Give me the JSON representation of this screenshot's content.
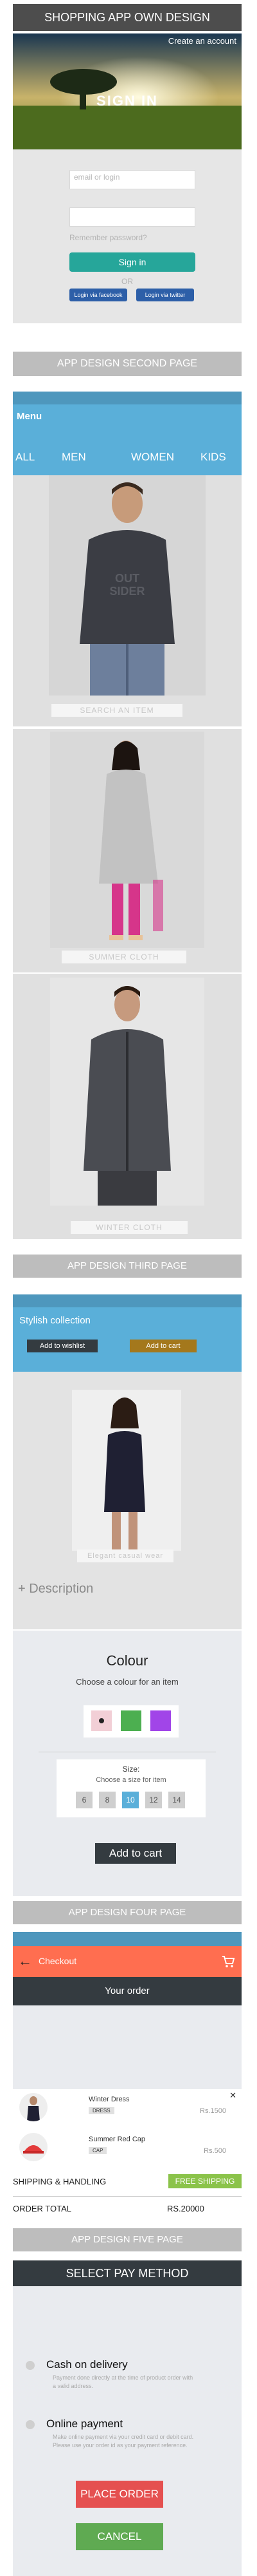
{
  "page1": {
    "header_title": "SHOPPING APP OWN DESIGN",
    "create_account": "Create an account",
    "sign_in_title": "SIGN IN",
    "email_placeholder": "email or login",
    "password_placeholder": "",
    "remember_password": "Remember password?",
    "sign_in_button": "Sign in",
    "or_text": "OR",
    "login_facebook": "Login via facebook",
    "login_twitter": "Login via twitter"
  },
  "page2": {
    "banner": "APP DESIGN SECOND PAGE",
    "menu_label": "Menu",
    "tabs": [
      "ALL",
      "MEN",
      "WOMEN",
      "KIDS"
    ],
    "products": [
      {
        "caption": "SEARCH AN ITEM",
        "shirt_text": "OUT SIDER"
      },
      {
        "caption": "SUMMER CLOTH"
      },
      {
        "caption": "WINTER CLOTH"
      }
    ]
  },
  "page3": {
    "banner": "APP DESIGN THIRD PAGE",
    "collection_title": "Stylish collection",
    "add_to_wishlist": "Add to wishlist",
    "add_to_cart_top": "Add to cart",
    "image_caption": "Elegant casual wear",
    "description_label": "+ Description",
    "colour_title": "Colour",
    "colour_subtitle": "Choose a colour for an item",
    "colours": [
      "#f2cfd6",
      "#4caf50",
      "#a145e8"
    ],
    "size_title": "Size:",
    "size_subtitle": "Choose a size for item",
    "sizes": [
      "6",
      "8",
      "10",
      "12",
      "14"
    ],
    "selected_size": "10",
    "add_to_cart_button": "Add to cart"
  },
  "page4": {
    "banner": "APP DESIGN FOUR PAGE",
    "checkout_label": "Checkout",
    "your_order": "Your order",
    "items": [
      {
        "name": "Winter Dress",
        "tag": "DRESS",
        "price": "Rs.1500"
      },
      {
        "name": "Summer Red Cap",
        "tag": "CAP",
        "price": "Rs.500"
      }
    ],
    "shipping_label": "SHIPPING & HANDLING",
    "shipping_value": "FREE SHIPPING",
    "order_total_label": "ORDER TOTAL",
    "order_total_value": "RS.20000"
  },
  "page5": {
    "banner": "APP DESIGN FIVE PAGE",
    "select_pay_method": "SELECT PAY METHOD",
    "cod_label": "Cash on delivery",
    "cod_desc": "Payment done directly at the time of product order with a valid address.",
    "online_label": "Online payment",
    "online_desc": "Make online payment via your credit card or debit card. Please use your order id as your payment reference.",
    "place_order": "PLACE ORDER",
    "cancel": "CANCEL"
  },
  "colors": {
    "teal": "#26a69a",
    "blue": "#5aafd9",
    "orange_red": "#ff6e50",
    "dark": "#343b40",
    "brown": "#a4781c",
    "red": "#e55050",
    "green": "#5faa52",
    "free_shipping_green": "#8bc34a"
  }
}
